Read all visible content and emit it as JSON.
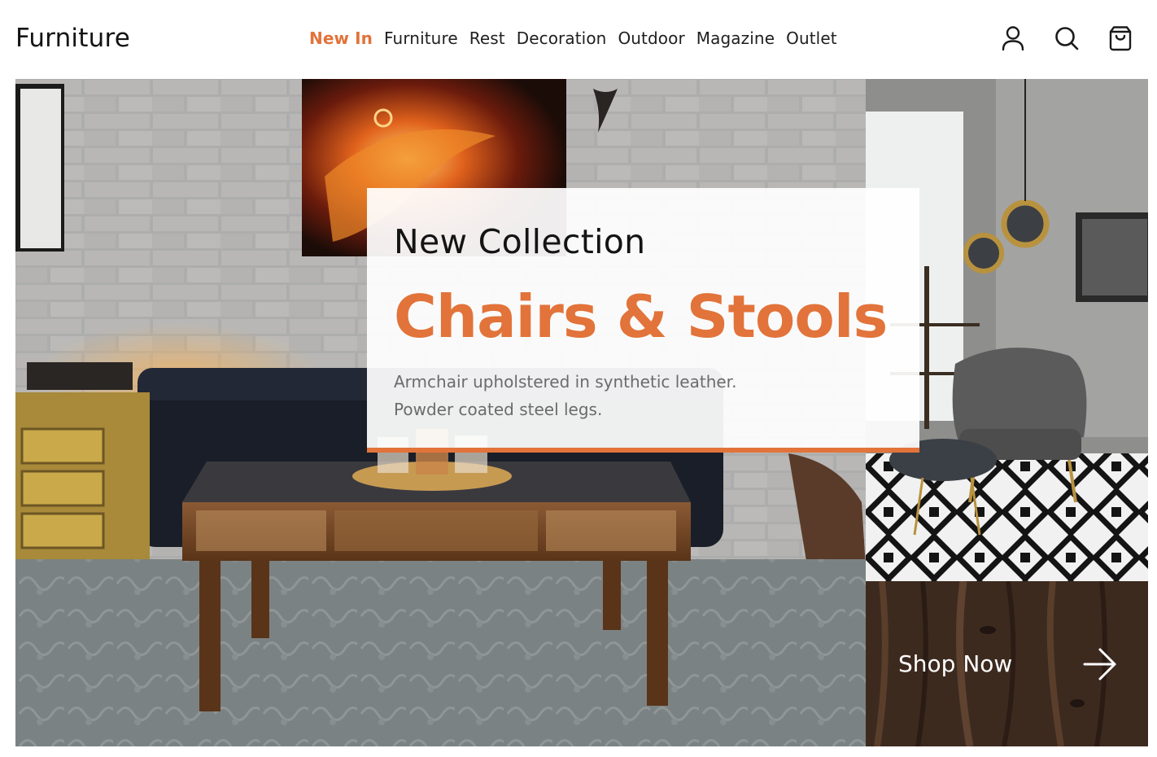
{
  "header": {
    "logo": "Furniture",
    "nav": [
      {
        "label": "New In",
        "active": true
      },
      {
        "label": "Furniture",
        "active": false
      },
      {
        "label": "Rest",
        "active": false
      },
      {
        "label": "Decoration",
        "active": false
      },
      {
        "label": "Outdoor",
        "active": false
      },
      {
        "label": "Magazine",
        "active": false
      },
      {
        "label": "Outlet",
        "active": false
      }
    ],
    "icons": [
      "user-icon",
      "search-icon",
      "shopping-bag-icon"
    ]
  },
  "hero": {
    "eyebrow": "New Collection",
    "title": "Chairs & Stools",
    "description_line1": "Armchair upholstered in synthetic leather.",
    "description_line2": "Powder coated steel legs.",
    "cta_label": "Shop Now",
    "cta_icon": "arrow-right-icon"
  },
  "colors": {
    "accent": "#e2733a",
    "text": "#141414",
    "muted": "#6b6b6b"
  }
}
